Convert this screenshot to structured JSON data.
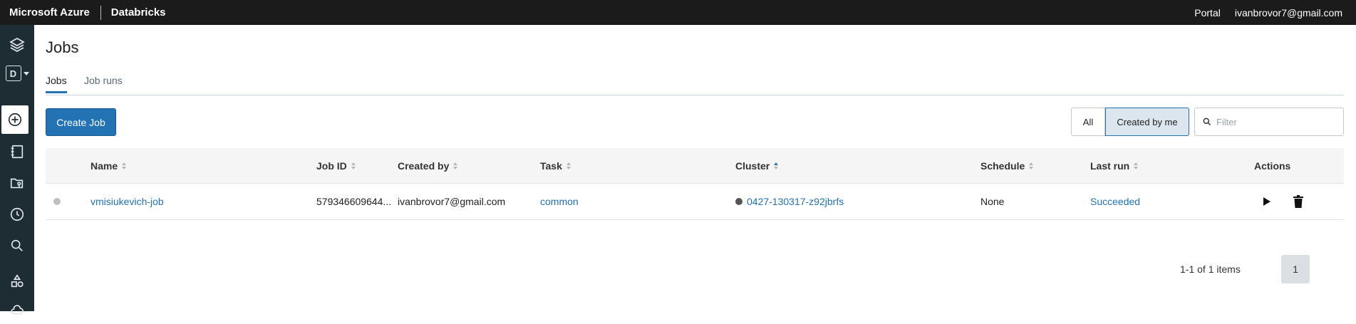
{
  "topbar": {
    "brand": "Microsoft Azure",
    "product": "Databricks",
    "portal": "Portal",
    "user": "ivanbrovor7@gmail.com"
  },
  "sidebar": {
    "workspace_letter": "D",
    "items": [
      "layers-icon",
      "workspace-switcher",
      "create-icon",
      "notebook-icon",
      "repos-icon",
      "recents-icon",
      "search-icon",
      "shapes-icon",
      "cloud-icon"
    ]
  },
  "page": {
    "title": "Jobs",
    "tabs": [
      {
        "label": "Jobs",
        "active": true
      },
      {
        "label": "Job runs",
        "active": false
      }
    ],
    "create_button": "Create Job",
    "filter_toggle": {
      "all": "All",
      "created_by_me": "Created by me",
      "selected": "Created by me"
    },
    "filter_placeholder": "Filter"
  },
  "table": {
    "columns": [
      "Name",
      "Job ID",
      "Created by",
      "Task",
      "Cluster",
      "Schedule",
      "Last run",
      "Actions"
    ],
    "sorted_column": "Cluster",
    "rows": [
      {
        "name": "vmisiukevich-job",
        "job_id": "579346609644...",
        "created_by": "ivanbrovor7@gmail.com",
        "task": "common",
        "cluster": "0427-130317-z92jbrfs",
        "schedule": "None",
        "last_run": "Succeeded"
      }
    ]
  },
  "pagination": {
    "summary": "1-1 of 1 items",
    "current_page": "1"
  },
  "colors": {
    "accent": "#2272b4",
    "topbar": "#1b1b1b",
    "sidebar": "#1e2c34"
  }
}
